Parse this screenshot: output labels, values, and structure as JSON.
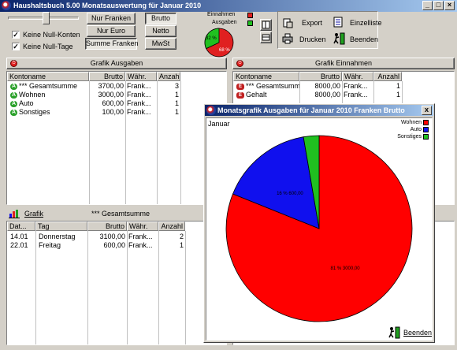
{
  "window": {
    "title": "Haushaltsbuch 5.00  Monatsauswertung für Januar 2010"
  },
  "controls": {
    "checkbox_null_konten": {
      "label": "Keine Null-Konten",
      "checked": true
    },
    "checkbox_null_tage": {
      "label": "Keine Null-Tage",
      "checked": true
    },
    "btn_nur_franken": "Nur Franken",
    "btn_nur_euro": "Nur Euro",
    "btn_summe_franken": "Summe Franken",
    "btn_brutto": "Brutto",
    "btn_netto": "Netto",
    "btn_mwst": "MwSt",
    "btn_export": "Export",
    "btn_einzelliste": "Einzelliste",
    "btn_drucken": "Drucken",
    "btn_beenden": "Beenden"
  },
  "mini_pie": {
    "legend": [
      {
        "label": "Einnahmen",
        "color": "#e02020"
      },
      {
        "label": "Ausgaben",
        "color": "#20c020"
      }
    ],
    "label_green": "32 %",
    "label_red": "68 %",
    "green_fraction": 0.32
  },
  "ausgaben": {
    "header": "Grafik Ausgaben",
    "columns": [
      "Kontoname",
      "Brutto",
      "Währ.",
      "Anzahl"
    ],
    "rows": [
      [
        "*** Gesamtsumme",
        "3700,00",
        "Frank...",
        "3"
      ],
      [
        "Wohnen",
        "3000,00",
        "Frank...",
        "1"
      ],
      [
        "Auto",
        "600,00",
        "Frank...",
        "1"
      ],
      [
        "Sonstiges",
        "100,00",
        "Frank...",
        "1"
      ]
    ]
  },
  "einnahmen": {
    "header": "Grafik Einnahmen",
    "columns": [
      "Kontoname",
      "Brutto",
      "Währ.",
      "Anzahl"
    ],
    "rows": [
      [
        "*** Gesamtsumme",
        "8000,00",
        "Frank...",
        "1"
      ],
      [
        "Gehalt",
        "8000,00",
        "Frank...",
        "1"
      ]
    ]
  },
  "details": {
    "grafik_label": "Grafik",
    "selected": "*** Gesamtsumme",
    "columns": [
      "Dat...",
      "Tag",
      "Brutto",
      "Währ.",
      "Anzahl"
    ],
    "rows": [
      [
        "14.01",
        "Donnerstag",
        "3100,00",
        "Frank...",
        "2"
      ],
      [
        "22.01",
        "Freitag",
        "600,00",
        "Frank...",
        "1"
      ]
    ]
  },
  "popup": {
    "title": "Monatsgrafik Ausgaben für Januar 2010 Franken Brutto",
    "close": "x",
    "month_label": "Januar",
    "legend": [
      {
        "label": "Wohnen",
        "color": "#ff0000"
      },
      {
        "label": "Auto",
        "color": "#1010ee"
      },
      {
        "label": "Sonstiges",
        "color": "#20c020"
      }
    ],
    "beenden": "Beenden"
  },
  "chart_data": {
    "type": "pie",
    "title": "Monatsgrafik Ausgaben für Januar 2010 Franken Brutto",
    "categories": [
      "Wohnen",
      "Auto",
      "Sonstiges"
    ],
    "values": [
      3000,
      600,
      100
    ],
    "slice_labels": [
      "81 %  3000,00",
      "16 %  600,00",
      ""
    ],
    "colors": [
      "#ff0000",
      "#1010ee",
      "#20c020"
    ]
  }
}
